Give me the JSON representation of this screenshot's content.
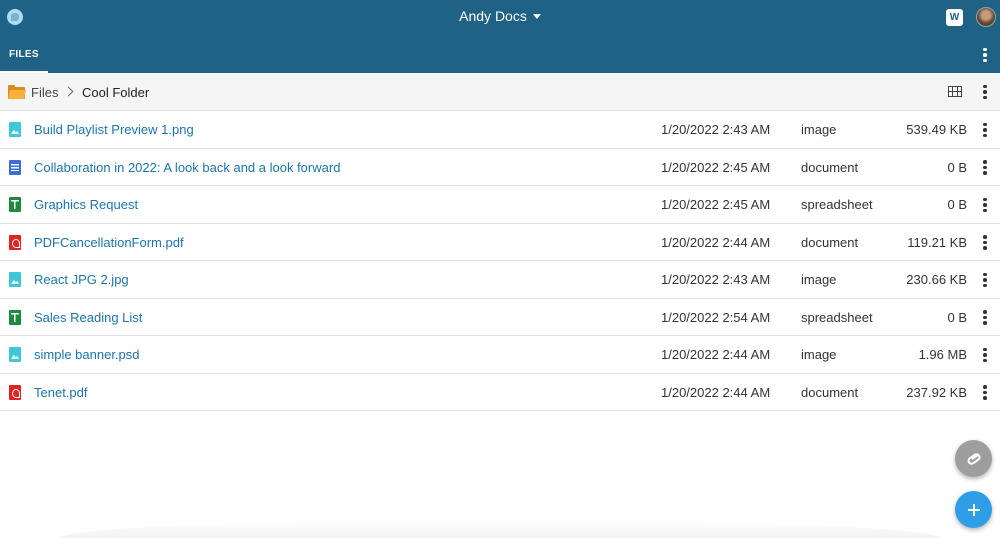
{
  "header": {
    "app_title": "Andy Docs",
    "active_tab": "FILES",
    "notification_badge": "W",
    "colors": {
      "header_bg": "#1f6285",
      "link": "#1b75ad",
      "fab_add": "#2f9ee6",
      "fab_attach": "#9e9e9e"
    }
  },
  "breadcrumb": {
    "root": "Files",
    "current": "Cool Folder"
  },
  "files": [
    {
      "name": "Build Playlist Preview 1.png",
      "date": "1/20/2022 2:43 AM",
      "type": "image",
      "size": "539.49 KB",
      "icon": "image-file-icon"
    },
    {
      "name": "Collaboration in 2022: A look back and a look forward",
      "date": "1/20/2022 2:45 AM",
      "type": "document",
      "size": "0 B",
      "icon": "document-file-icon"
    },
    {
      "name": "Graphics Request",
      "date": "1/20/2022 2:45 AM",
      "type": "spreadsheet",
      "size": "0 B",
      "icon": "spreadsheet-file-icon"
    },
    {
      "name": "PDFCancellationForm.pdf",
      "date": "1/20/2022 2:44 AM",
      "type": "document",
      "size": "119.21 KB",
      "icon": "pdf-file-icon"
    },
    {
      "name": "React JPG 2.jpg",
      "date": "1/20/2022 2:43 AM",
      "type": "image",
      "size": "230.66 KB",
      "icon": "image-file-icon"
    },
    {
      "name": "Sales Reading List",
      "date": "1/20/2022 2:54 AM",
      "type": "spreadsheet",
      "size": "0 B",
      "icon": "spreadsheet-file-icon"
    },
    {
      "name": "simple banner.psd",
      "date": "1/20/2022 2:44 AM",
      "type": "image",
      "size": "1.96 MB",
      "icon": "image-file-icon"
    },
    {
      "name": "Tenet.pdf",
      "date": "1/20/2022 2:44 AM",
      "type": "document",
      "size": "237.92 KB",
      "icon": "pdf-file-icon"
    }
  ]
}
